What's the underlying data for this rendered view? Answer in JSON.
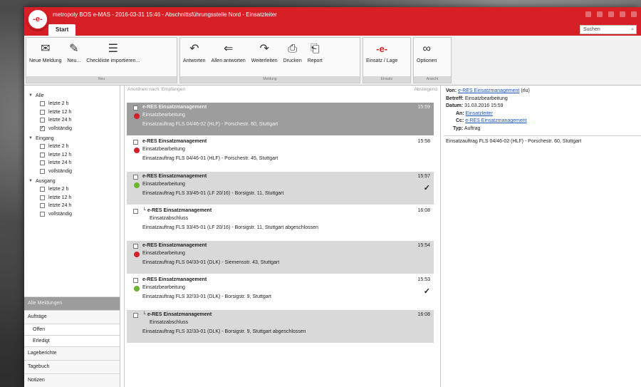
{
  "window": {
    "title": "metropoly BOS e-MAS - 2016-03-31 15:46 - Abschnittsführungsstelle Nord - Einsatzleiter",
    "logo_text": "-e-"
  },
  "tabs": {
    "start": "Start"
  },
  "search": {
    "placeholder": "Suchen"
  },
  "ribbon": {
    "groups": [
      {
        "label": "Neu",
        "buttons": [
          {
            "label": "Neue Meldung",
            "icon": "envelope-icon"
          },
          {
            "label": "Neu...",
            "icon": "edit-icon"
          },
          {
            "label": "Checkliste importieren...",
            "icon": "checklist-icon"
          }
        ]
      },
      {
        "label": "Meldung",
        "buttons": [
          {
            "label": "Antworten",
            "icon": "reply-icon"
          },
          {
            "label": "Allen antworten",
            "icon": "reply-all-icon"
          },
          {
            "label": "Weiterleiten",
            "icon": "forward-icon"
          },
          {
            "label": "Drucken",
            "icon": "print-icon"
          },
          {
            "label": "Report",
            "icon": "report-icon"
          }
        ]
      },
      {
        "label": "Einsatz",
        "buttons": [
          {
            "label": "Einsatz / Lage",
            "icon": "emas-logo-icon"
          }
        ]
      },
      {
        "label": "Ansicht",
        "buttons": [
          {
            "label": "Optionen",
            "icon": "binoculars-icon"
          }
        ]
      }
    ]
  },
  "nav": {
    "tree": [
      {
        "label": "Alle",
        "items": [
          "letzte 2 h",
          "letzte 12 h",
          "letzte 24 h",
          "vollständig"
        ],
        "checked": 3
      },
      {
        "label": "Eingang",
        "items": [
          "letzte 2 h",
          "letzte 12 h",
          "letzte 24 h",
          "vollständig"
        ],
        "checked": -1
      },
      {
        "label": "Ausgang",
        "items": [
          "letzte 2 h",
          "letzte 12 h",
          "letzte 24 h",
          "vollständig"
        ],
        "checked": -1
      }
    ],
    "bottom": {
      "all": "Alle Meldungen",
      "orders": "Aufträge",
      "open": "Offen",
      "done": "Erledigt",
      "reports": "Lageberichte",
      "diary": "Tagebuch",
      "notes": "Notizen"
    }
  },
  "list": {
    "header_left": "Anordnen nach: Empfangen",
    "header_right": "Absteigend",
    "messages": [
      {
        "sender": "e-RES Einsatzmanagement",
        "subject": "Einsatzbearbeitung",
        "text": "Einsatzauftrag FLS 04/46-02 (HLF) - Porschestr. 60, Stuttgart",
        "time": "15:59",
        "status": "red",
        "check": "",
        "style": "selected",
        "reply": false
      },
      {
        "sender": "e-RES Einsatzmanagement",
        "subject": "Einsatzbearbeitung",
        "text": "Einsatzauftrag FLS 04/46-01 (HLF) - Porschestr. 45, Stuttgart",
        "time": "15:58",
        "status": "red",
        "check": "",
        "style": "white",
        "reply": false
      },
      {
        "sender": "e-RES Einsatzmanagement",
        "subject": "Einsatzbearbeitung",
        "text": "Einsatzauftrag FLS 33/45-01 (LF 20/16) - Borsigstr. 11, Stuttgart",
        "time": "15:57",
        "status": "green",
        "check": "✓",
        "style": "grey",
        "reply": false
      },
      {
        "sender": "e-RES Einsatzmanagement",
        "subject": "Einsatzabschluss",
        "text": "Einsatzauftrag FLS 33/45-01 (LF 20/16) - Borsigstr. 11, Stuttgart abgeschlossen",
        "time": "16:08",
        "status": "",
        "check": "",
        "style": "white",
        "reply": true
      },
      {
        "sender": "e-RES Einsatzmanagement",
        "subject": "Einsatzbearbeitung",
        "text": "Einsatzauftrag FLS 04/33-01 (DLK) - Siemensstr. 43, Stuttgart",
        "time": "15:54",
        "status": "red",
        "check": "",
        "style": "grey",
        "reply": false
      },
      {
        "sender": "e-RES Einsatzmanagement",
        "subject": "Einsatzbearbeitung",
        "text": "Einsatzauftrag FLS 32/33-01 (DLK) - Borsigstr. 9, Stuttgart",
        "time": "15:53",
        "status": "green",
        "check": "✓",
        "style": "white",
        "reply": false
      },
      {
        "sender": "e-RES Einsatzmanagement",
        "subject": "Einsatzabschluss",
        "text": "Einsatzauftrag FLS 32/33-01 (DLK) - Borsigstr. 9, Stuttgart abgeschlossen",
        "time": "16:08",
        "status": "",
        "check": "",
        "style": "grey",
        "reply": true
      }
    ]
  },
  "detail": {
    "from_label": "Von:",
    "from_value": "e-RES Einsatzmanagement",
    "from_suffix": "(rlu)",
    "subject_label": "Betreff:",
    "subject_value": "Einsatzbearbeitung",
    "date_label": "Datum:",
    "date_value": "31.03.2016 15:59",
    "to_label": "An:",
    "to_value": "Einsatzleiter",
    "cc_label": "Cc:",
    "cc_value": "e-RES Einsatzmanagement",
    "type_label": "Typ:",
    "type_value": "Auftrag",
    "body": "Einsatzauftrag FLS 04/46-02 (HLF) - Porschestr. 60, Stuttgart"
  },
  "colors": {
    "accent": "#d71f26",
    "status_red": "#d0202a",
    "status_green": "#6ab42f",
    "link": "#1a56b8"
  }
}
